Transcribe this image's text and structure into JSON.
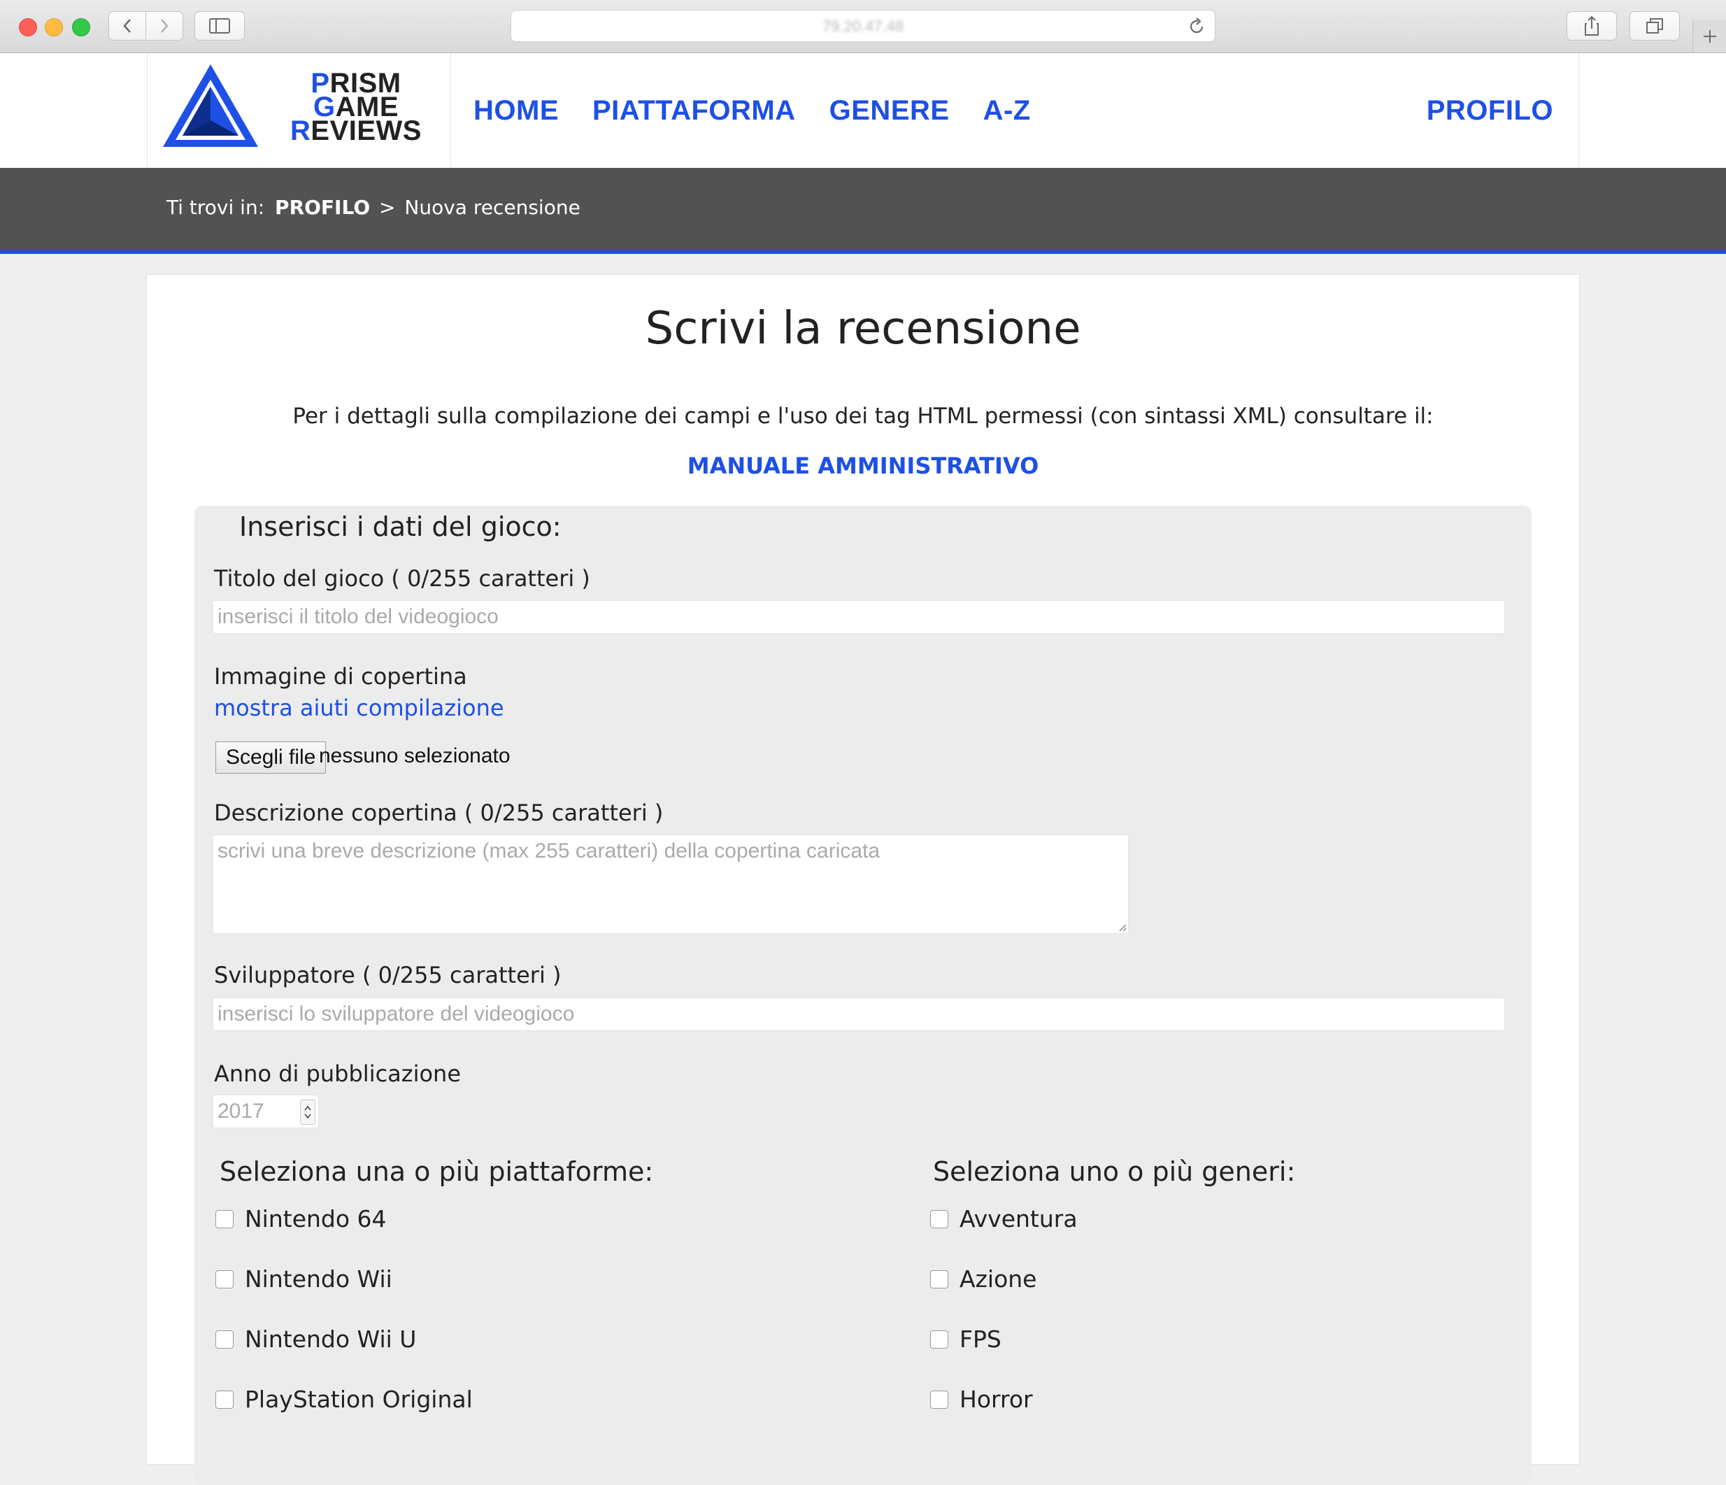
{
  "browser": {
    "url": "79.20.47.48"
  },
  "header": {
    "logo": {
      "line1_cap1": "P",
      "line1_rest1": "RISM ",
      "line1_cap2": "G",
      "line1_rest2": "AME",
      "line2_cap": "R",
      "line2_rest": "EVIEWS"
    },
    "nav": [
      "HOME",
      "PIATTAFORMA",
      "GENERE",
      "A-Z"
    ],
    "profile": "PROFILO"
  },
  "breadcrumb": {
    "prefix": "Ti trovi in:",
    "link": "PROFILO",
    "separator": ">",
    "current": "Nuova recensione"
  },
  "page": {
    "title": "Scrivi la recensione",
    "intro": "Per i dettagli sulla compilazione dei campi e l'uso dei tag HTML permessi (con sintassi XML) consultare il:",
    "manual_link": "MANUALE AMMINISTRATIVO"
  },
  "form": {
    "legend": "Inserisci i dati del gioco:",
    "title_label": "Titolo del gioco ( 0/255 caratteri )",
    "title_placeholder": "inserisci il titolo del videogioco",
    "cover_label": "Immagine di copertina",
    "cover_help": "mostra aiuti compilazione",
    "file_button": "Scegli file",
    "file_status": "nessuno selezionato",
    "cover_desc_label": "Descrizione copertina ( 0/255 caratteri )",
    "cover_desc_placeholder": "scrivi una breve descrizione (max 255 caratteri) della copertina caricata",
    "developer_label": "Sviluppatore ( 0/255 caratteri )",
    "developer_placeholder": "inserisci lo sviluppatore del videogioco",
    "year_label": "Anno di pubblicazione",
    "year_value": "2017",
    "platforms_title": "Seleziona una o più piattaforme:",
    "platforms": [
      "Nintendo 64",
      "Nintendo Wii",
      "Nintendo Wii U",
      "PlayStation Original"
    ],
    "genres_title": "Seleziona uno o più generi:",
    "genres": [
      "Avventura",
      "Azione",
      "FPS",
      "Horror"
    ]
  },
  "colors": {
    "accent": "#1e50e6",
    "breadcrumb_bg": "#525252",
    "page_bg": "#efefef",
    "fieldset_bg": "#ececec"
  }
}
